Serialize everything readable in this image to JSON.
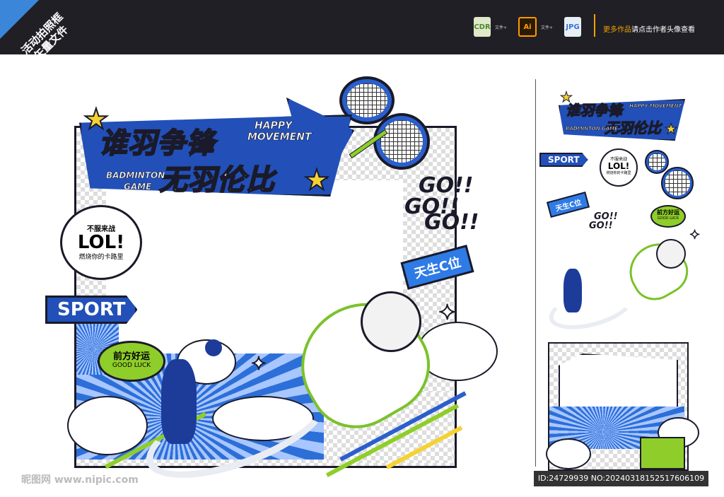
{
  "ribbon": {
    "line1": "活动拍照框",
    "line2": "矢量文件"
  },
  "header": {
    "file_types": [
      {
        "name": "cdr-file-icon",
        "label": "CDR",
        "sub": "文件+"
      },
      {
        "name": "ai-file-icon",
        "label": "Ai",
        "sub": "文件+"
      },
      {
        "name": "jpg-file-icon",
        "label": "JPG",
        "sub": ""
      }
    ],
    "more_highlight": "更多作品",
    "more_rest": "请点击作者头像查看"
  },
  "main": {
    "title_line1": "谁羽争锋",
    "title_line2": "无羽伦比",
    "title_en1": "HAPPY",
    "title_en2": "MOVEMENT",
    "title_en3": "BADMINTON",
    "title_en4": "GAME",
    "bubble_top": "不服来战",
    "bubble_lol": "LOL!",
    "bubble_bottom": "燃烧你的卡路里",
    "sport": "SPORT",
    "good_cn": "前方好运",
    "good_en": "GOOD LUCK",
    "go1": "GO!!",
    "go2": "GO!!",
    "go3": "GO!!",
    "tian": "天生C位"
  },
  "side": {
    "title_line1": "谁羽争锋",
    "title_line2": "无羽伦比",
    "en1": "HAPPY MOVEMENT",
    "en2": "BADMINTON GAME",
    "sport": "SPORT",
    "bubble_top": "不服来战",
    "bubble_lol": "LOL!",
    "bubble_bottom": "燃烧你的卡路里",
    "tian": "天生C位",
    "go": "GO!!",
    "good_cn": "前方好运",
    "good_en": "GOOD LUCK"
  },
  "watermark": {
    "left": "昵图网 www.nipic.com",
    "id": "ID:24729939 NO:20240318152517606109"
  },
  "colors": {
    "dark": "#1a1a2a",
    "blue": "#2a5fcc",
    "green": "#8fce2a",
    "yellow": "#f5d233",
    "orange": "#f0a000"
  }
}
